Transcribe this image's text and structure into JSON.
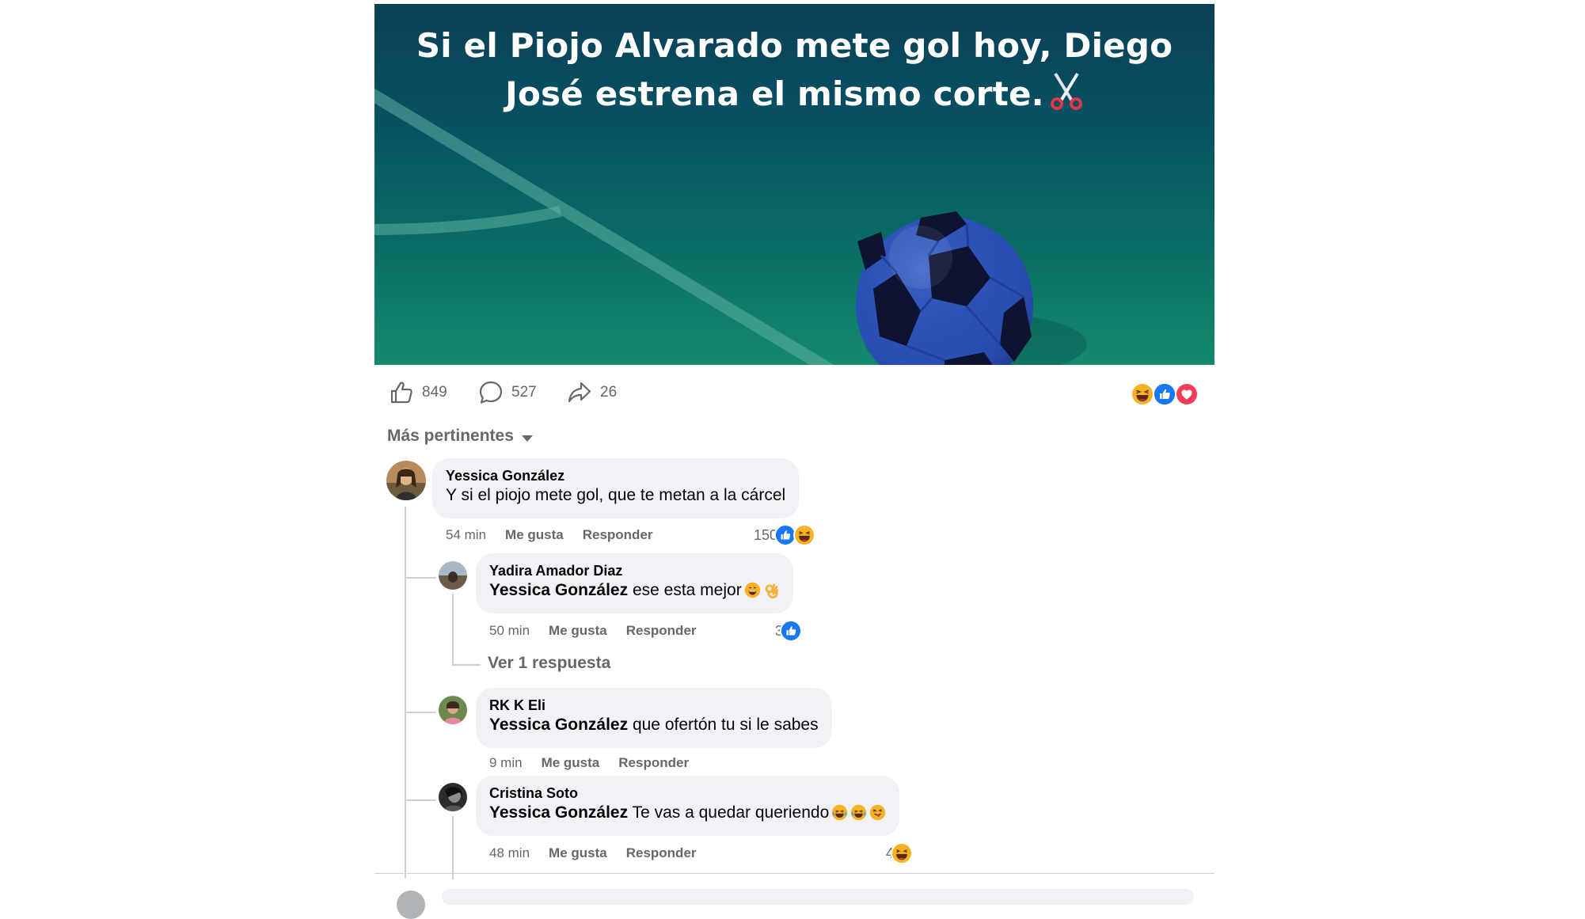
{
  "post": {
    "banner_text": "Si el Piojo Alvarado mete gol hoy, Diego José estrena el mismo corte.",
    "banner_emoji": "scissors-icon"
  },
  "stats": {
    "likes": "849",
    "comments": "527",
    "shares": "26",
    "reaction_icons": [
      "haha-reaction-icon",
      "like-reaction-icon",
      "love-reaction-icon"
    ]
  },
  "sort": {
    "label": "Más pertinentes"
  },
  "comments": [
    {
      "author": "Yessica González",
      "text": "Y si el piojo mete gol, que te metan a la cárcel",
      "time": "54 min",
      "like_label": "Me gusta",
      "reply_label": "Responder",
      "reaction_count": "150",
      "replies": [
        {
          "author": "Yadira Amador Diaz",
          "mention": "Yessica González",
          "text": "ese esta mejor",
          "time": "50 min",
          "like_label": "Me gusta",
          "reply_label": "Responder",
          "reaction_count": "3",
          "view_replies": "Ver 1 respuesta"
        },
        {
          "author": "RK K Eli",
          "mention": "Yessica González",
          "text": "que ofertón tu si le sabes",
          "time": "9 min",
          "like_label": "Me gusta",
          "reply_label": "Responder"
        },
        {
          "author": "Cristina Soto",
          "mention": "Yessica González",
          "text": "Te vas a quedar queriendo",
          "time": "48 min",
          "like_label": "Me gusta",
          "reply_label": "Responder",
          "reaction_count": "4"
        }
      ]
    }
  ],
  "colors": {
    "facebook_blue": "#1877f2",
    "love_red": "#f33e58",
    "haha_yellow": "#f7b125",
    "secondary_text": "#65676b",
    "bubble_bg": "#f0f2f5"
  }
}
